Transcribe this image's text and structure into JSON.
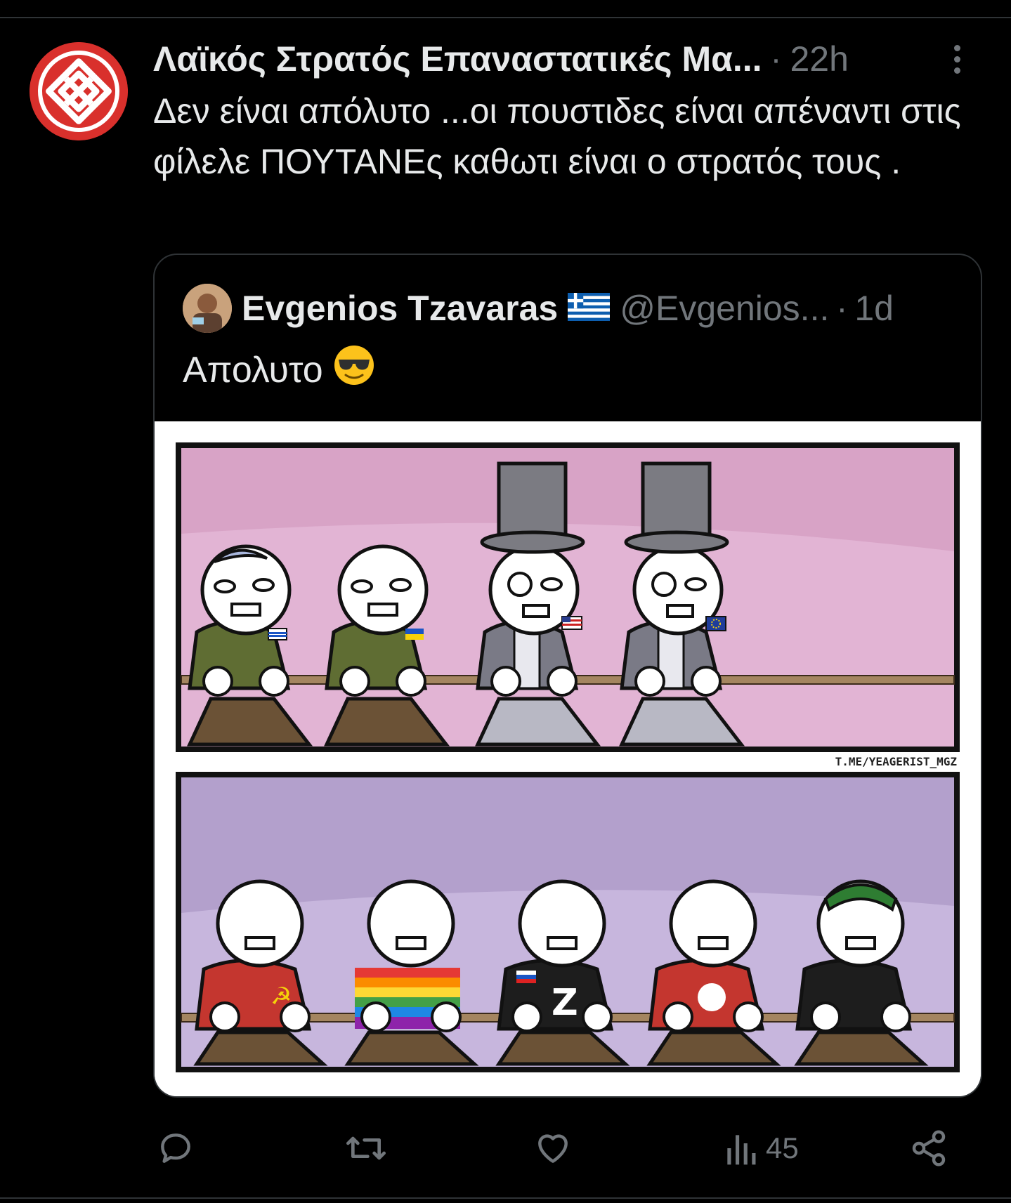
{
  "tweet": {
    "author_display": "Λαϊκός Στρατός Επαναστατικές Μα...",
    "separator": "·",
    "time": "22h",
    "text": "Δεν είναι απόλυτο ...οι πουστιδες είναι απέναντι στις φίλελε ΠΟΥΤΑΝΕς καθωτι είναι ο στρατός τους ."
  },
  "quote": {
    "author_name": "Evgenios Tzavaras",
    "flag": "greece-flag-icon",
    "handle": "@Evgenios...",
    "separator": "·",
    "time": "1d",
    "text": "Απολυτο",
    "emoji": "sunglasses-face-emoji",
    "comic": {
      "watermark": "T.ME/YEAGERIST_MGZ",
      "panel_top_bg": "#d8a3c6",
      "panel_bottom_bg": "#b3a0cc"
    }
  },
  "actions": {
    "reply": "reply-icon",
    "retweet": "retweet-icon",
    "like": "like-icon",
    "views_count": "45",
    "share": "share-icon"
  },
  "colors": {
    "background": "#000000",
    "text_primary": "#e7e9ea",
    "text_secondary": "#71767b",
    "border": "#2f3336",
    "avatar_red": "#d9302c"
  }
}
